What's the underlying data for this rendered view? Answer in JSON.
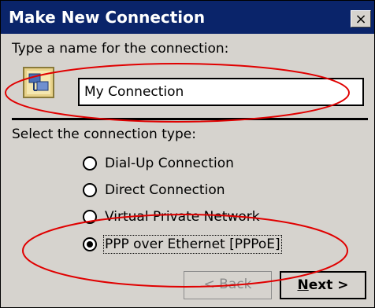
{
  "window": {
    "title": "Make New Connection",
    "close_glyph": "×",
    "colors": {
      "titlebar": "#0a246a",
      "face": "#d6d3ce",
      "annotation": "#e00000"
    }
  },
  "name_section": {
    "label": "Type a name for the connection:",
    "icon": "network-connection-icon",
    "value": "My Connection"
  },
  "type_section": {
    "label": "Select the connection type:",
    "options": [
      {
        "label": "Dial-Up Connection",
        "checked": false
      },
      {
        "label": "Direct Connection",
        "checked": false
      },
      {
        "label": "Virtual Private Network",
        "checked": false
      },
      {
        "label": "PPP over Ethernet [PPPoE]",
        "checked": true
      }
    ]
  },
  "buttons": {
    "back_label": "< Back",
    "back_enabled": false,
    "next_label": "Next >"
  }
}
